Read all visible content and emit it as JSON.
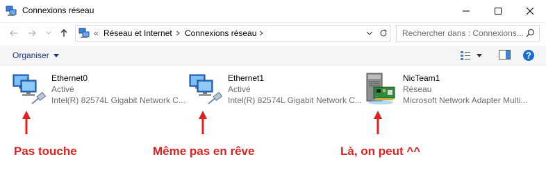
{
  "window": {
    "title": "Connexions réseau",
    "icon": "network-connections-icon"
  },
  "address": {
    "overflow": "«",
    "crumbs": [
      "Réseau et Internet",
      "Connexions réseau"
    ],
    "search_placeholder": "Rechercher dans : Connexions..."
  },
  "toolbar": {
    "organize_label": "Organiser"
  },
  "connections": [
    {
      "name": "Ethernet0",
      "status": "Activé",
      "description": "Intel(R) 82574L Gigabit Network C...",
      "icon": "ethernet-adapter-icon"
    },
    {
      "name": "Ethernet1",
      "status": "Activé",
      "description": "Intel(R) 82574L Gigabit Network C...",
      "icon": "ethernet-adapter-icon"
    },
    {
      "name": "NicTeam1",
      "status": "Réseau",
      "description": "Microsoft Network Adapter Multi...",
      "icon": "nic-team-adapter-icon"
    }
  ],
  "annotations": [
    {
      "text": "Pas touche",
      "color": "#e02020"
    },
    {
      "text": "Même pas en rêve",
      "color": "#e02020"
    },
    {
      "text": "Là, on peut ^^",
      "color": "#e02020"
    }
  ],
  "colors": {
    "accent_link": "#1e3287",
    "annotation_red": "#e02020",
    "help_blue": "#1a6fd1"
  }
}
